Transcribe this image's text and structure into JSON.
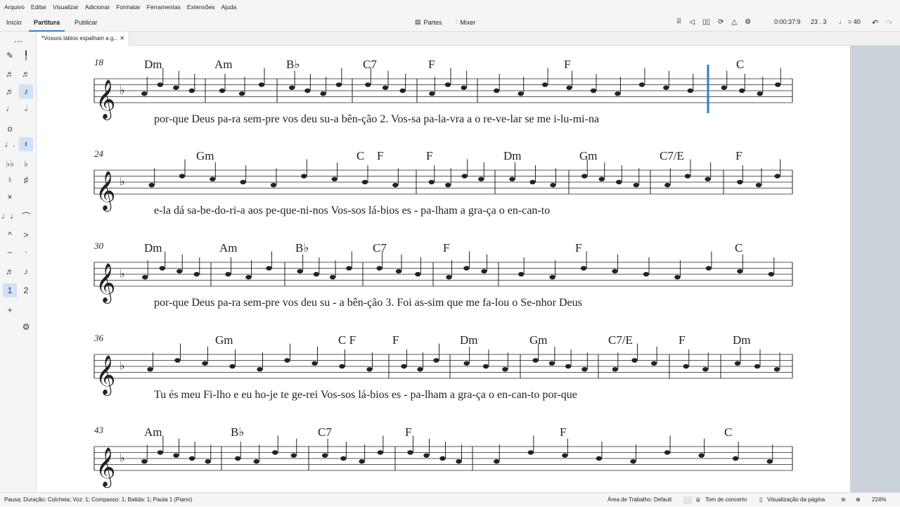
{
  "menu": [
    "Arquivo",
    "Editar",
    "Visualizar",
    "Adicionar",
    "Formatar",
    "Ferramentas",
    "Extensões",
    "Ajuda"
  ],
  "tabs": {
    "inicio": "Início",
    "partitura": "Partitura",
    "publicar": "Publicar"
  },
  "toolbar": {
    "partes": "Partes",
    "mixer": "Mixer",
    "time": "0:00:37:9",
    "position": "23 . 3",
    "tempo": "= 40"
  },
  "document": {
    "tab_title": "*Vossos lábios espalham a g..."
  },
  "status": {
    "left": "Pausa; Duração: Colcheia; Voz: 1; Compasso: 1; Batida: 1; Pauta 1 (Piano)",
    "workspace": "Área de Trabalho: Default",
    "concert": "Tom de concerto",
    "view": "Visualização da página",
    "zoom": "224%"
  },
  "score": {
    "systems": [
      {
        "measure": "18",
        "chords": [
          "Dm",
          "Am",
          "B♭",
          "C7",
          "F",
          "F",
          "C"
        ],
        "lyrics": "por-que Deus pa-ra  sem-pre vos  deu su-a   bên-ção   2. Vos-sa pa-la-vra a o re-ve-lar se me i-lu-mi-na"
      },
      {
        "measure": "24",
        "chords": [
          "Gm",
          "C",
          "F",
          "F",
          "Dm",
          "Gm",
          "C7/E",
          "F"
        ],
        "lyrics": "e-la dá sa-be-do-ri-a aos pe-que-ni-nos        Vos-sos  lá-bios es - pa-lham a   gra-ça o en-can-to"
      },
      {
        "measure": "30",
        "chords": [
          "Dm",
          "Am",
          "B♭",
          "C7",
          "F",
          "F",
          "C"
        ],
        "lyrics": "por-que Deus pa-ra  sem-pre vos  deu su - a   bên-ção   3. Foi as-sim que me fa-lou o Se-nhor Deus"
      },
      {
        "measure": "36",
        "chords": [
          "Gm",
          "C F",
          "F",
          "Dm",
          "Gm",
          "C7/E",
          "F",
          "Dm"
        ],
        "lyrics": "Tu és meu Fi-lho e eu ho-je te ge-rei      Vos-sos  lá-bios es - pa-lham a   gra-ça o en-can-to     por-que"
      },
      {
        "measure": "43",
        "chords": [
          "Am",
          "B♭",
          "C7",
          "F",
          "F",
          "C"
        ],
        "lyrics": ""
      }
    ]
  }
}
